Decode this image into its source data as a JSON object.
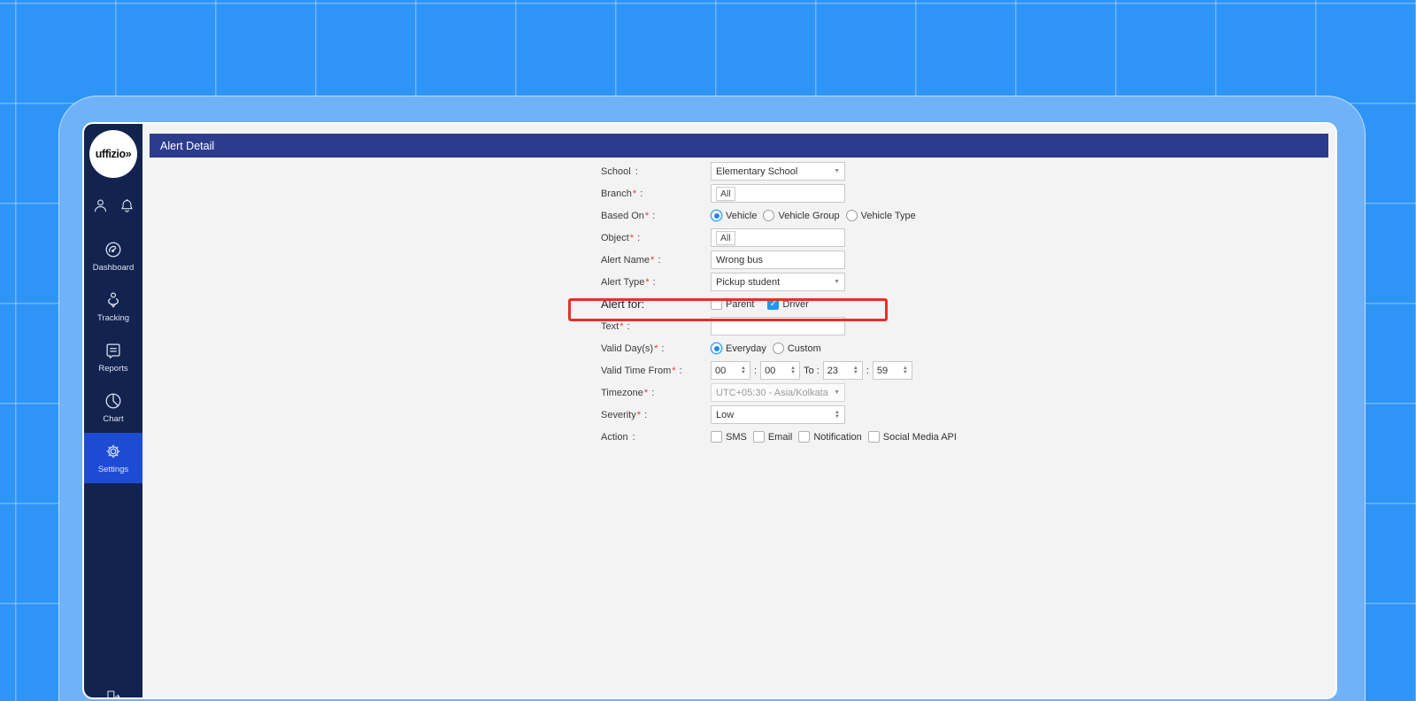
{
  "colors": {
    "background": "#2e95f6",
    "frame": "#6fb2f7",
    "sidebar": "#12234f",
    "sidebar_active": "#1d4bd4",
    "titlebar": "#2b3c8e",
    "content": "#f3f3f4",
    "accent": "#2196f3",
    "highlight_red": "#e53026",
    "required_red": "#e53935"
  },
  "icons": {
    "chevron_down": "▼",
    "spin_up": "▲",
    "spin_down": "▼",
    "check": "✓"
  },
  "sidebar": {
    "logo": "uffizio»",
    "top_icons": [
      {
        "name": "user-icon"
      },
      {
        "name": "bell-icon"
      }
    ],
    "items": [
      {
        "label": "Dashboard",
        "icon": "dashboard-icon",
        "active": false
      },
      {
        "label": "Tracking",
        "icon": "tracking-icon",
        "active": false
      },
      {
        "label": "Reports",
        "icon": "reports-icon",
        "active": false
      },
      {
        "label": "Chart",
        "icon": "chart-icon",
        "active": false
      },
      {
        "label": "Settings",
        "icon": "settings-icon",
        "active": true
      }
    ],
    "bottom_icon": "logout-icon"
  },
  "header": {
    "title": "Alert Detail"
  },
  "form": {
    "school": {
      "label": "School",
      "req": "",
      "colon": " :",
      "value": "Elementary School"
    },
    "branch": {
      "label": "Branch",
      "req": "*",
      "colon": " :",
      "chip": "All"
    },
    "based_on": {
      "label": "Based On",
      "req": "*",
      "colon": " :",
      "options": [
        {
          "label": "Vehicle",
          "selected": true
        },
        {
          "label": "Vehicle Group",
          "selected": false
        },
        {
          "label": "Vehicle Type",
          "selected": false
        }
      ]
    },
    "object": {
      "label": "Object",
      "req": "*",
      "colon": " :",
      "chip": "All"
    },
    "alert_name": {
      "label": "Alert Name",
      "req": "*",
      "colon": " :",
      "value": "Wrong bus"
    },
    "alert_type": {
      "label": "Alert Type",
      "req": "*",
      "colon": " :",
      "value": "Pickup student"
    },
    "alert_for": {
      "label": "Alert for:",
      "req": "",
      "colon": "",
      "options": [
        {
          "label": "Parent",
          "checked": false
        },
        {
          "label": "Driver",
          "checked": true
        }
      ]
    },
    "text": {
      "label": "Text",
      "req": "*",
      "colon": " :",
      "value": ""
    },
    "valid_days": {
      "label": "Valid Day(s)",
      "req": "*",
      "colon": " :",
      "options": [
        {
          "label": "Everyday",
          "selected": true
        },
        {
          "label": "Custom",
          "selected": false
        }
      ]
    },
    "valid_time": {
      "label": "Valid Time From",
      "req": "*",
      "colon": " :",
      "from_hour": "00",
      "from_min": "00",
      "sep": ":",
      "to_label": "To :",
      "to_hour": "23",
      "to_min": "59"
    },
    "timezone": {
      "label": "Timezone",
      "req": "*",
      "colon": " :",
      "value": "UTC+05:30 - Asia/Kolkata"
    },
    "severity": {
      "label": "Severity",
      "req": "*",
      "colon": " :",
      "value": "Low"
    },
    "action": {
      "label": "Action",
      "req": "",
      "colon": " :",
      "options": [
        {
          "label": "SMS",
          "checked": false
        },
        {
          "label": "Email",
          "checked": false
        },
        {
          "label": "Notification",
          "checked": false
        },
        {
          "label": "Social Media API",
          "checked": false
        }
      ]
    }
  }
}
